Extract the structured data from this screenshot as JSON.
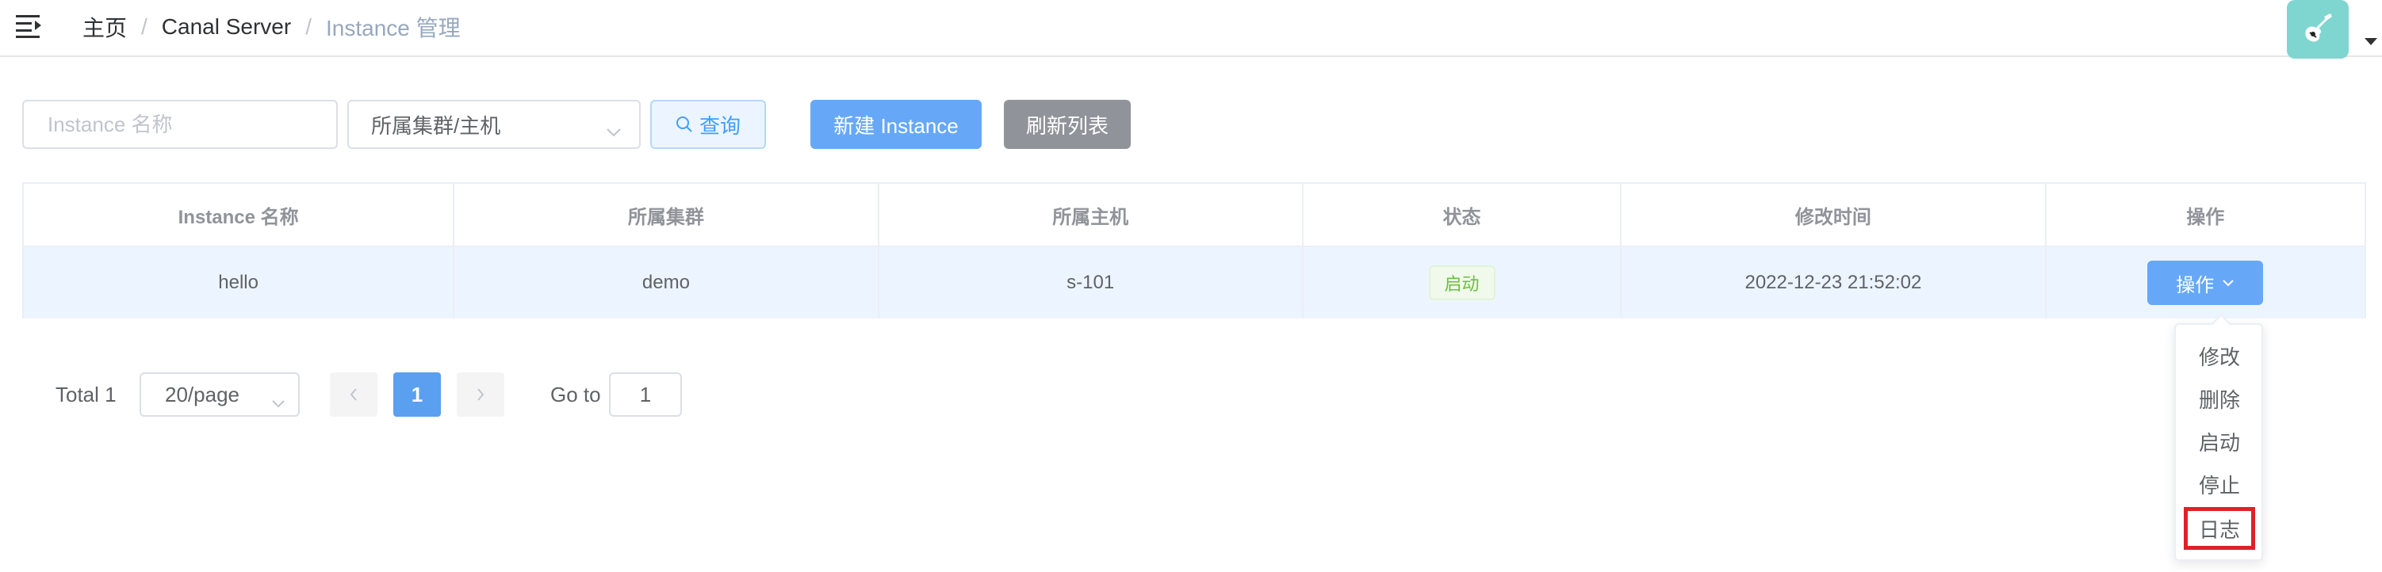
{
  "header": {
    "breadcrumb": [
      "主页",
      "Canal Server",
      "Instance 管理"
    ]
  },
  "filters": {
    "name_placeholder": "Instance 名称",
    "cluster_select_value": "所属集群/主机",
    "query_label": "查询",
    "new_label": "新建 Instance",
    "refresh_label": "刷新列表"
  },
  "table": {
    "columns": [
      "Instance 名称",
      "所属集群",
      "所属主机",
      "状态",
      "修改时间",
      "操作"
    ],
    "rows": [
      {
        "name": "hello",
        "cluster": "demo",
        "host": "s-101",
        "status": "启动",
        "modified": "2022-12-23 21:52:02",
        "action_label": "操作"
      }
    ]
  },
  "dropdown": {
    "items": [
      "修改",
      "删除",
      "启动",
      "停止",
      "日志"
    ]
  },
  "pagination": {
    "total": "Total 1",
    "page_size": "20/page",
    "current_page": "1",
    "goto_label": "Go to",
    "goto_value": "1"
  },
  "colors": {
    "primary": "#66a8f7",
    "status_running": "#67c23a",
    "highlight": "#e0202b"
  }
}
